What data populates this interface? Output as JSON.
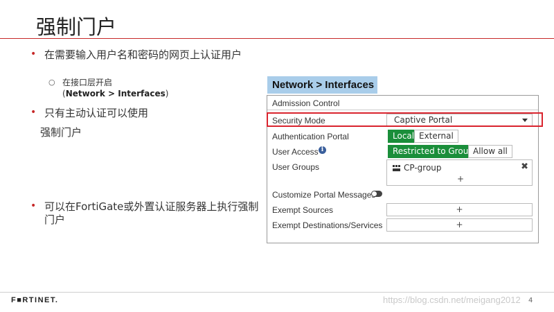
{
  "slide": {
    "title": "强制门户",
    "bullets": [
      "在需要输入用户名和密码的网页上认证用户",
      "只有主动认证可以使用",
      "可以在FortiGate或外置认证服务器上执行强制门户"
    ],
    "bullet2_cont": "强制门户",
    "sub_line1": "在接口层开启",
    "sub_line2_pre": "(",
    "sub_line2_bold": "Network > Interfaces",
    "sub_line2_post": ")"
  },
  "panel": {
    "header": "Network > Interfaces",
    "section_title": "Admission Control",
    "security_mode_label": "Security Mode",
    "security_mode_value": "Captive Portal",
    "auth_portal_label": "Authentication Portal",
    "auth_portal_options": [
      "Local",
      "External"
    ],
    "user_access_label": "User Access",
    "user_access_options": [
      "Restricted to Groups",
      "Allow all"
    ],
    "user_groups_label": "User Groups",
    "user_group_item": "CP-group",
    "customize_label": "Customize Portal Messages",
    "exempt_sources_label": "Exempt Sources",
    "exempt_dest_label": "Exempt Destinations/Services",
    "plus": "+",
    "remove": "✖",
    "info": "i"
  },
  "footer": {
    "logo": "F■RTINET.",
    "watermark": "https://blog.csdn.net/meigang2012",
    "page": "4"
  },
  "colors": {
    "accent_red": "#c62828",
    "highlight_red": "#d9232d",
    "active_green": "#1a8e3a",
    "header_blue": "#a9cdea"
  }
}
